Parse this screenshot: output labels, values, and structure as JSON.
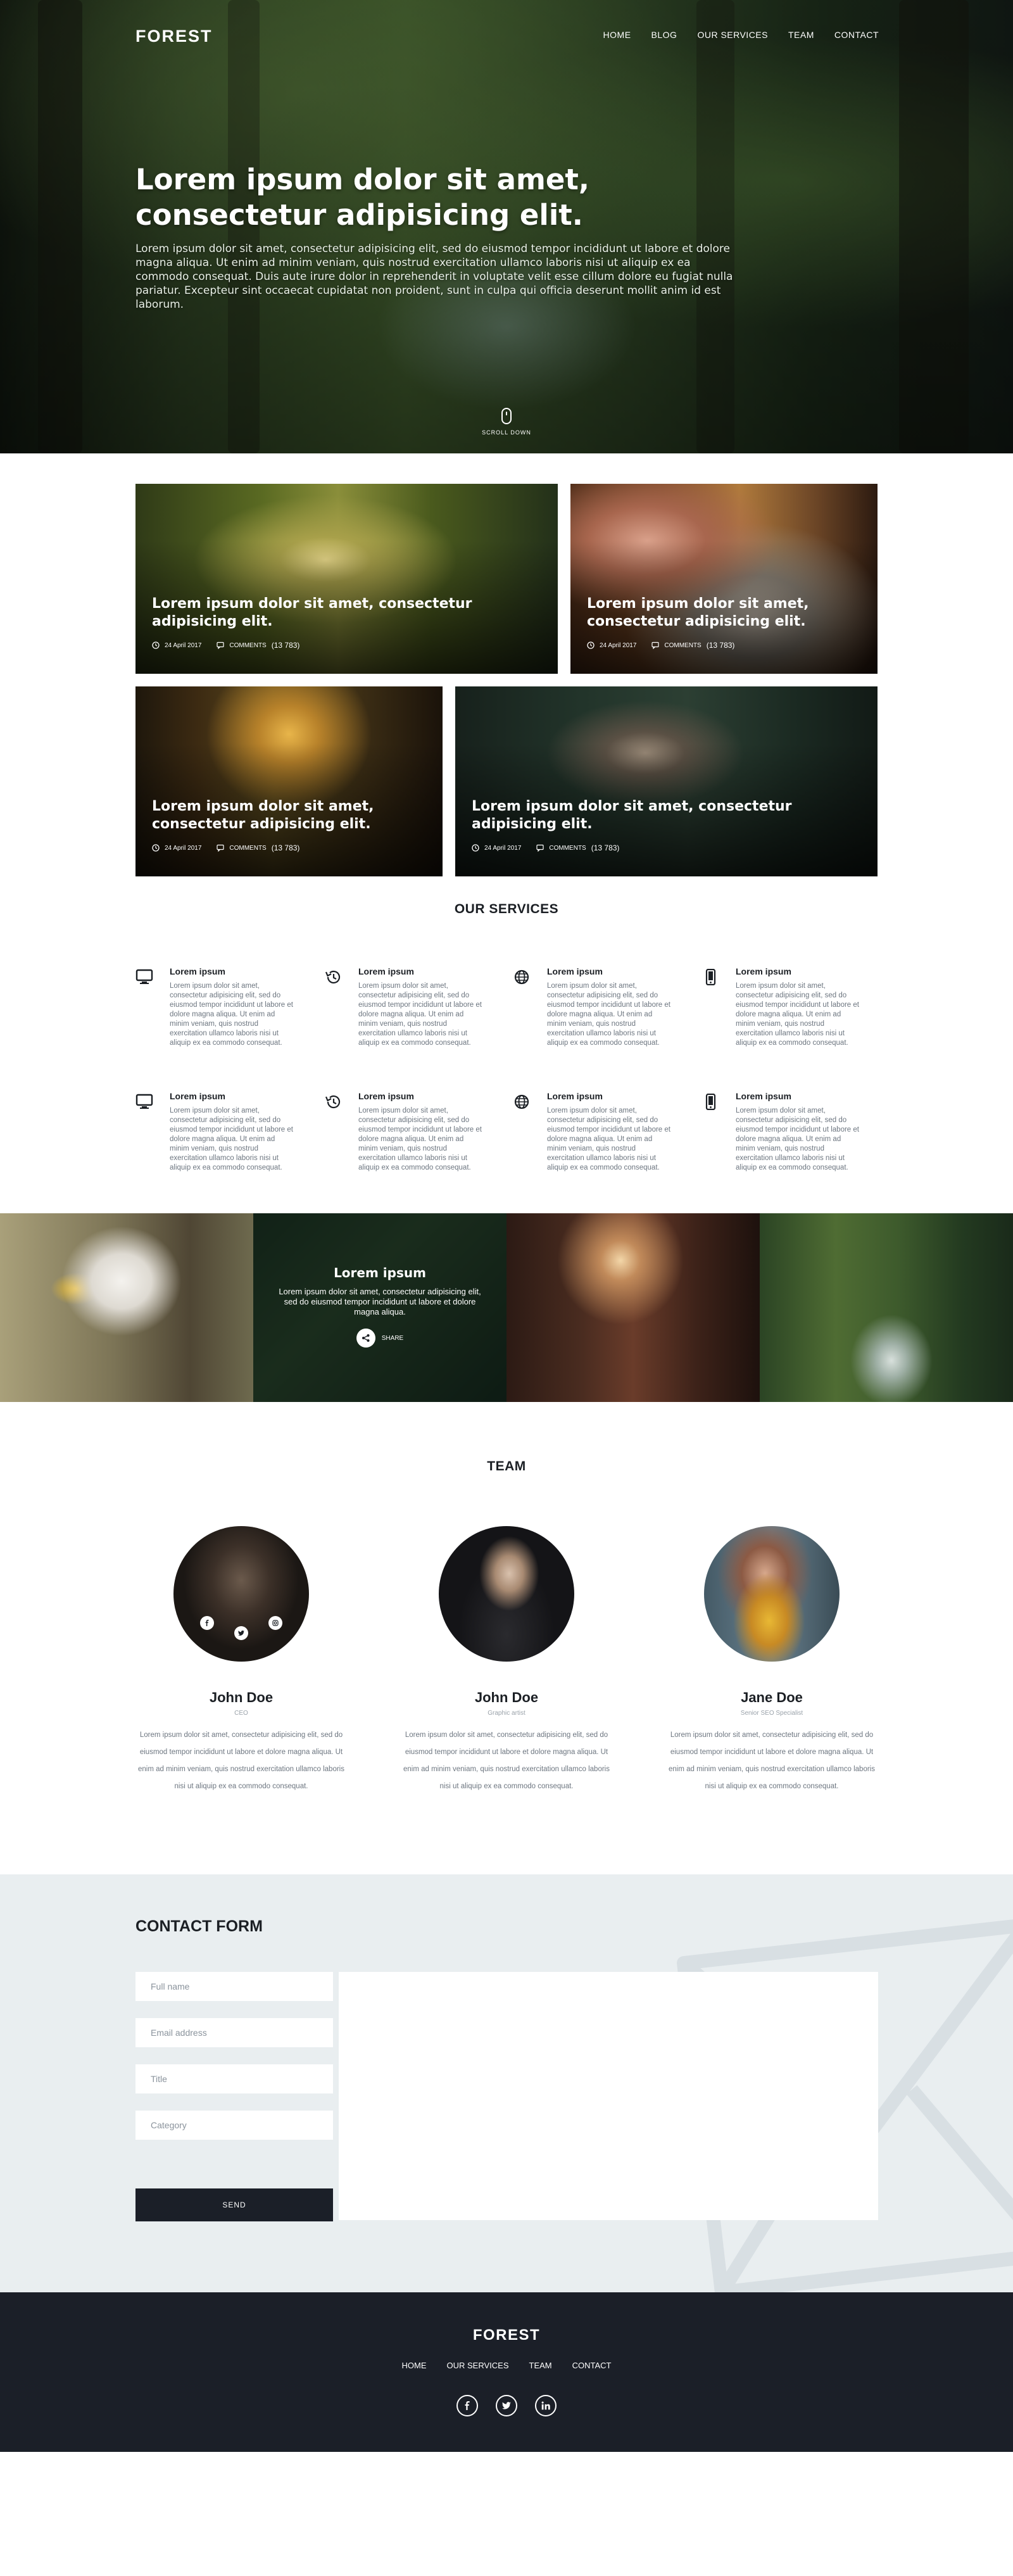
{
  "brand": "FOREST",
  "nav": [
    "HOME",
    "BLOG",
    "OUR SERVICES",
    "TEAM",
    "CONTACT"
  ],
  "hero": {
    "title": "Lorem ipsum dolor sit amet, consectetur adipisicing elit.",
    "text": "Lorem ipsum dolor sit amet, consectetur adipisicing elit, sed do eiusmod tempor incididunt ut labore et dolore magna aliqua. Ut enim ad minim veniam, quis nostrud exercitation ullamco laboris nisi ut aliquip ex ea commodo consequat. Duis aute irure dolor in reprehenderit in voluptate velit esse cillum dolore eu fugiat nulla pariatur. Excepteur sint occaecat cupidatat non proident, sunt in culpa qui officia deserunt mollit anim id est laborum.",
    "scroll_label": "SCROLL DOWN"
  },
  "articles": [
    {
      "title": "Lorem ipsum dolor sit amet, consectetur adipisicing elit.",
      "date": "24 April 2017",
      "comments_label": "COMMENTS",
      "comments_count": "(13 783)"
    },
    {
      "title": "Lorem ipsum dolor sit amet, consectetur adipisicing elit.",
      "date": "24 April 2017",
      "comments_label": "COMMENTS",
      "comments_count": "(13 783)"
    },
    {
      "title": "Lorem ipsum dolor sit amet, consectetur adipisicing elit.",
      "date": "24 April 2017",
      "comments_label": "COMMENTS",
      "comments_count": "(13 783)"
    },
    {
      "title": "Lorem ipsum dolor sit amet, consectetur adipisicing elit.",
      "date": "24 April 2017",
      "comments_label": "COMMENTS",
      "comments_count": "(13 783)"
    }
  ],
  "services": {
    "title": "OUR SERVICES",
    "items": [
      {
        "icon": "monitor-icon",
        "title": "Lorem ipsum",
        "text": "Lorem ipsum dolor sit amet, consectetur adipisicing elit, sed do eiusmod tempor incididunt ut labore et dolore magna aliqua. Ut enim ad minim veniam, quis nostrud exercitation ullamco laboris nisi ut aliquip ex ea commodo consequat."
      },
      {
        "icon": "history-icon",
        "title": "Lorem ipsum",
        "text": "Lorem ipsum dolor sit amet, consectetur adipisicing elit, sed do eiusmod tempor incididunt ut labore et dolore magna aliqua. Ut enim ad minim veniam, quis nostrud exercitation ullamco laboris nisi ut aliquip ex ea commodo consequat."
      },
      {
        "icon": "globe-icon",
        "title": "Lorem ipsum",
        "text": "Lorem ipsum dolor sit amet, consectetur adipisicing elit, sed do eiusmod tempor incididunt ut labore et dolore magna aliqua. Ut enim ad minim veniam, quis nostrud exercitation ullamco laboris nisi ut aliquip ex ea commodo consequat."
      },
      {
        "icon": "phone-icon",
        "title": "Lorem ipsum",
        "text": "Lorem ipsum dolor sit amet, consectetur adipisicing elit, sed do eiusmod tempor incididunt ut labore et dolore magna aliqua. Ut enim ad minim veniam, quis nostrud exercitation ullamco laboris nisi ut aliquip ex ea commodo consequat."
      },
      {
        "icon": "monitor-icon",
        "title": "Lorem ipsum",
        "text": "Lorem ipsum dolor sit amet, consectetur adipisicing elit, sed do eiusmod tempor incididunt ut labore et dolore magna aliqua. Ut enim ad minim veniam, quis nostrud exercitation ullamco laboris nisi ut aliquip ex ea commodo consequat."
      },
      {
        "icon": "history-icon",
        "title": "Lorem ipsum",
        "text": "Lorem ipsum dolor sit amet, consectetur adipisicing elit, sed do eiusmod tempor incididunt ut labore et dolore magna aliqua. Ut enim ad minim veniam, quis nostrud exercitation ullamco laboris nisi ut aliquip ex ea commodo consequat."
      },
      {
        "icon": "globe-icon",
        "title": "Lorem ipsum",
        "text": "Lorem ipsum dolor sit amet, consectetur adipisicing elit, sed do eiusmod tempor incididunt ut labore et dolore magna aliqua. Ut enim ad minim veniam, quis nostrud exercitation ullamco laboris nisi ut aliquip ex ea commodo consequat."
      },
      {
        "icon": "phone-icon",
        "title": "Lorem ipsum",
        "text": "Lorem ipsum dolor sit amet, consectetur adipisicing elit, sed do eiusmod tempor incididunt ut labore et dolore magna aliqua. Ut enim ad minim veniam, quis nostrud exercitation ullamco laboris nisi ut aliquip ex ea commodo consequat."
      }
    ]
  },
  "gallery": {
    "title": "Lorem ipsum",
    "text": "Lorem ipsum dolor sit amet, consectetur adipisicing elit, sed do eiusmod tempor incididunt ut labore et dolore magna aliqua.",
    "share_label": "SHARE"
  },
  "team": {
    "title": "TEAM",
    "members": [
      {
        "name": "John Doe",
        "role": "CEO",
        "bio": "Lorem ipsum dolor sit amet, consectetur adipisicing elit, sed do eiusmod tempor incididunt ut labore et dolore magna aliqua. Ut enim ad minim veniam, quis nostrud exercitation ullamco laboris nisi ut aliquip ex ea commodo consequat."
      },
      {
        "name": "John Doe",
        "role": "Graphic artist",
        "bio": "Lorem ipsum dolor sit amet, consectetur adipisicing elit, sed do eiusmod tempor incididunt ut labore et dolore magna aliqua. Ut enim ad minim veniam, quis nostrud exercitation ullamco laboris nisi ut aliquip ex ea commodo consequat."
      },
      {
        "name": "Jane Doe",
        "role": "Senior SEO Specialist",
        "bio": "Lorem ipsum dolor sit amet, consectetur adipisicing elit, sed do eiusmod tempor incididunt ut labore et dolore magna aliqua. Ut enim ad minim veniam, quis nostrud exercitation ullamco laboris nisi ut aliquip ex ea commodo consequat."
      }
    ]
  },
  "contact": {
    "title": "CONTACT FORM",
    "fields": {
      "full_name": "Full name",
      "email": "Email address",
      "title": "Title",
      "category": "Category"
    },
    "send_label": "SEND"
  },
  "footer": {
    "brand": "FOREST",
    "nav": [
      "HOME",
      "OUR SERVICES",
      "TEAM",
      "CONTACT"
    ],
    "social": [
      "facebook-icon",
      "twitter-icon",
      "linkedin-icon"
    ]
  },
  "colors": {
    "dark": "#1b1f28",
    "contact_bg": "#e9eef0",
    "text_muted": "#6d7680"
  }
}
